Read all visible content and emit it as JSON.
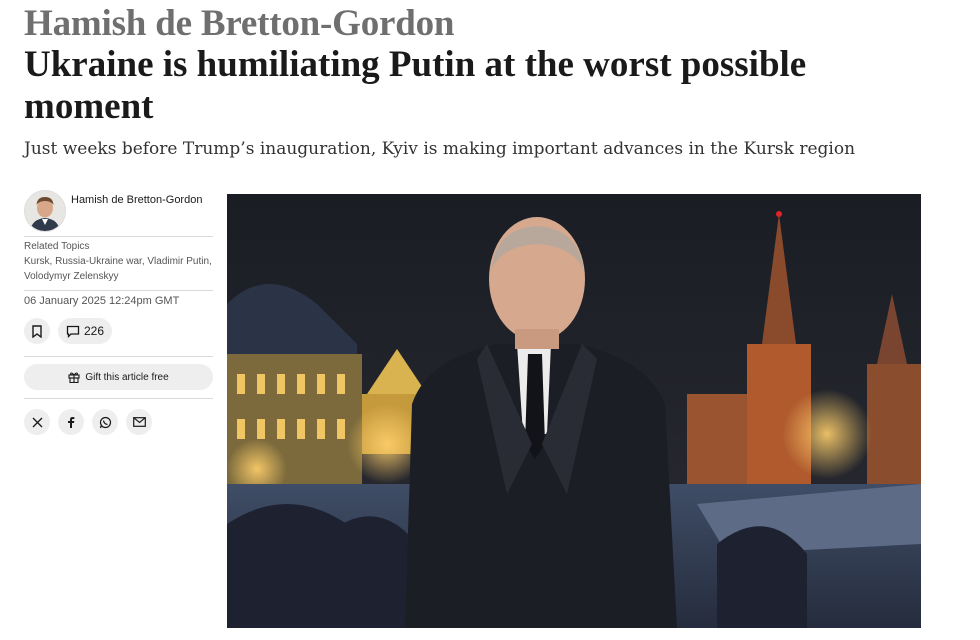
{
  "article": {
    "author_kicker": "Hamish de Bretton-Gordon",
    "headline": "Ukraine is humiliating Putin at the worst possible moment",
    "standfirst": "Just weeks before Trump’s inauguration, Kyiv is making important advances in the Kursk region"
  },
  "sidebar": {
    "author_name": "Hamish de Bretton-Gordon",
    "related_topics_title": "Related Topics",
    "related_topics": "Kursk, Russia-Ukraine war, Vladimir Putin, Volodymyr Zelenskyy",
    "timestamp": "06 January 2025 12:24pm GMT",
    "comment_count": "226",
    "gift_label": "Gift this article free",
    "share_icons": [
      "x-icon",
      "facebook-icon",
      "whatsapp-icon",
      "email-icon"
    ]
  },
  "hero_image": {
    "icon": "putin-kremlin-night-photo"
  },
  "colors": {
    "kicker": "#6f6f6f",
    "text": "#1a1a1a",
    "button_bg": "#eeeeee"
  }
}
